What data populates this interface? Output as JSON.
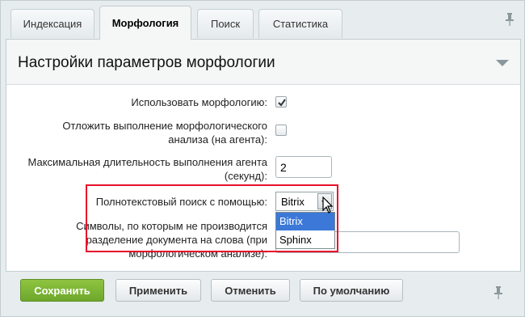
{
  "tabs": [
    {
      "label": "Индексация"
    },
    {
      "label": "Морфология"
    },
    {
      "label": "Поиск"
    },
    {
      "label": "Статистика"
    }
  ],
  "panel": {
    "title": "Настройки параметров морфологии"
  },
  "fields": {
    "use_morphology": {
      "label": "Использовать морфологию:",
      "checked": true
    },
    "defer_analysis": {
      "label_line1": "Отложить выполнение морфологического",
      "label_line2": "анализа (на агента):",
      "checked": false
    },
    "agent_duration": {
      "label_line1": "Максимальная длительность выполнения агента",
      "label_line2": "(секунд):",
      "value": "2"
    },
    "fulltext": {
      "label": "Полнотекстовый поиск с помощью:",
      "selected": "Bitrix",
      "options": [
        "Bitrix",
        "Sphinx"
      ]
    },
    "split_symbols": {
      "label_line1": "Символы, по которым не производится",
      "label_line2": "разделение документа на слова (при",
      "label_line3": "морфологическом анализе):",
      "value": ""
    }
  },
  "footer": {
    "save_label": "Сохранить",
    "apply_label": "Применить",
    "cancel_label": "Отменить",
    "default_label": "По умолчанию"
  },
  "colors": {
    "highlight": "#e8102a",
    "primary_button": "#7cb636",
    "option_selected": "#3b78d8"
  },
  "icons": [
    "pin-icon",
    "collapse-arrow-icon",
    "checkmark-icon",
    "chevron-down-icon",
    "mouse-cursor-icon"
  ]
}
